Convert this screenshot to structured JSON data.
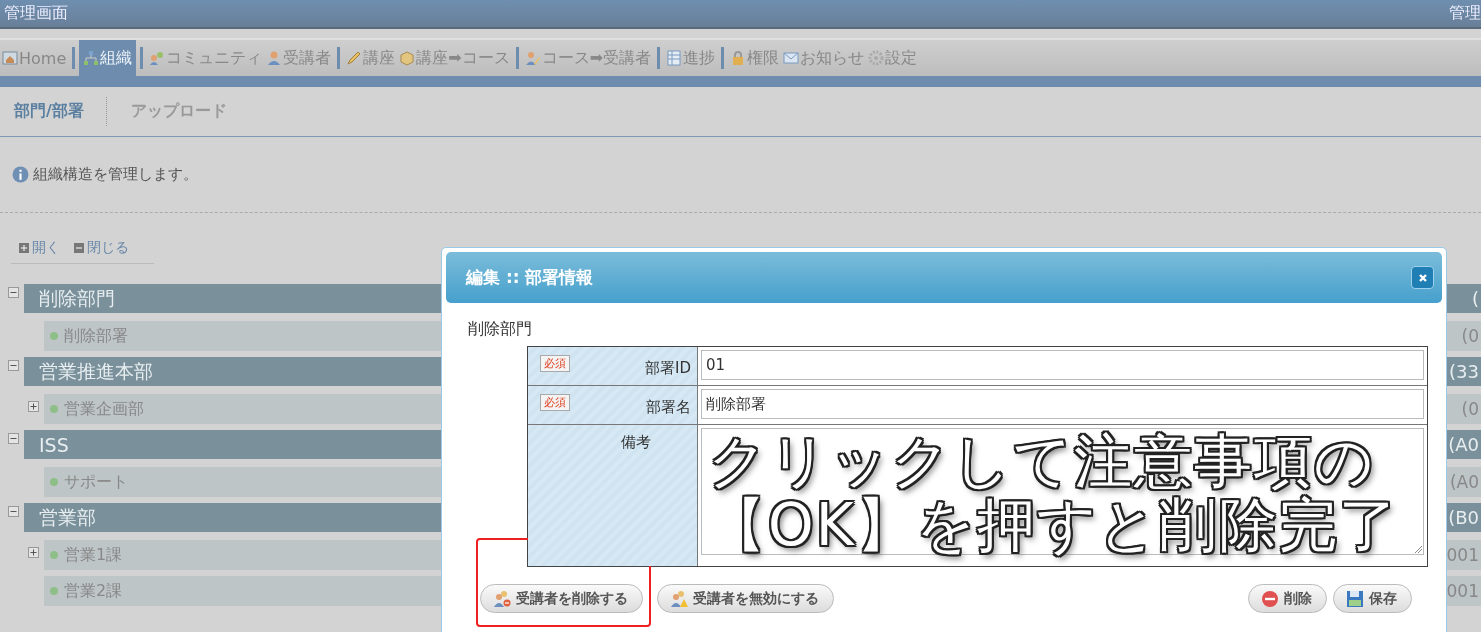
{
  "header": {
    "title": "管理画面",
    "user": "管理"
  },
  "nav": [
    {
      "label": "Home",
      "selected": false
    },
    {
      "label": "組織",
      "selected": true
    },
    {
      "label": "コミュニティ",
      "selected": false
    },
    {
      "label": "受講者",
      "selected": false
    },
    {
      "label": "講座",
      "selected": false
    },
    {
      "label": "講座➡コース",
      "selected": false
    },
    {
      "label": "コース➡受講者",
      "selected": false
    },
    {
      "label": "進捗",
      "selected": false
    },
    {
      "label": "権限",
      "selected": false
    },
    {
      "label": "お知らせ",
      "selected": false
    },
    {
      "label": "設定",
      "selected": false
    }
  ],
  "subtabs": [
    {
      "label": "部門/部署",
      "selected": true
    },
    {
      "label": "アップロード",
      "selected": false
    }
  ],
  "info": "組織構造を管理します。",
  "tree_tools": [
    {
      "label": "開く",
      "kind": "expand"
    },
    {
      "label": "閉じる",
      "kind": "collapse"
    }
  ],
  "tree": [
    {
      "name": "削除部門",
      "code": "(",
      "expanded": true,
      "children": [
        {
          "name": "削除部署",
          "code": "(0",
          "expandable": false
        }
      ]
    },
    {
      "name": "営業推進本部",
      "code": "(33",
      "expanded": true,
      "children": [
        {
          "name": "営業企画部",
          "code": "(0",
          "expandable": true
        }
      ]
    },
    {
      "name": "ISS",
      "code": "(A0",
      "expanded": true,
      "children": [
        {
          "name": "サポート",
          "code": "(A0",
          "expandable": false
        }
      ]
    },
    {
      "name": "営業部",
      "code": "(B0",
      "expanded": true,
      "children": [
        {
          "name": "営業1課",
          "code": "001",
          "expandable": true
        },
        {
          "name": "営業2課",
          "code": "001",
          "expandable": false
        }
      ]
    }
  ],
  "dialog": {
    "title": "編集 :: 部署情報",
    "section": "削除部門",
    "fields": [
      {
        "label": "部署ID",
        "badge": "必須",
        "value": "01",
        "kind": "input"
      },
      {
        "label": "部署名",
        "badge": "必須",
        "value": "削除部署",
        "kind": "input"
      },
      {
        "label": "備考",
        "kind": "textarea"
      }
    ],
    "buttons_left": [
      {
        "label": "受講者を削除する",
        "kind": "remove-users",
        "highlighted": true
      },
      {
        "label": "受講者を無効にする",
        "kind": "disable-users",
        "highlighted": false
      }
    ],
    "buttons_right": [
      {
        "label": "削除",
        "kind": "delete"
      },
      {
        "label": "保存",
        "kind": "save"
      }
    ]
  },
  "annotation": [
    "クリックして注意事項の",
    "【OK】を押すと削除完了"
  ]
}
